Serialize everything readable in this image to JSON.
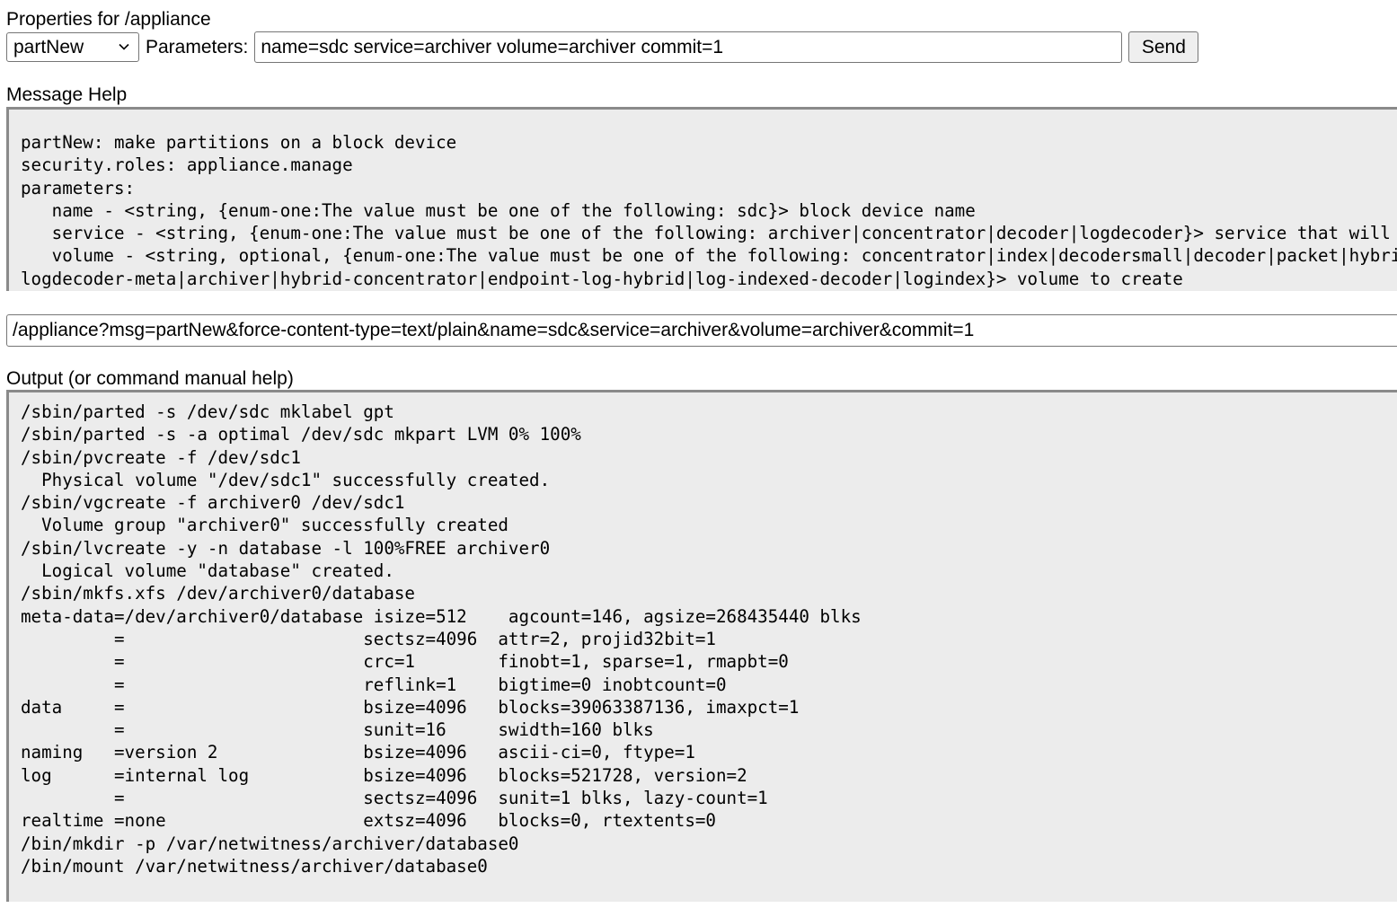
{
  "header": {
    "title": "Properties for /appliance"
  },
  "controls": {
    "message_select_value": "partNew",
    "parameters_label": "Parameters:",
    "parameters_value": "name=sdc service=archiver volume=archiver commit=1",
    "send_label": "Send"
  },
  "help": {
    "label": "Message Help",
    "text": "partNew: make partitions on a block device\nsecurity.roles: appliance.manage\nparameters:\n   name - <string, {enum-one:The value must be one of the following: sdc}> block device name\n   service - <string, {enum-one:The value must be one of the following: archiver|concentrator|decoder|logdecoder}> service that will\n   volume - <string, optional, {enum-one:The value must be one of the following: concentrator|index|decodersmall|decoder|packet|hybrid\nlogdecoder-meta|archiver|hybrid-concentrator|endpoint-log-hybrid|log-indexed-decoder|logindex}> volume to create"
  },
  "url": {
    "value": "/appliance?msg=partNew&force-content-type=text/plain&name=sdc&service=archiver&volume=archiver&commit=1"
  },
  "output": {
    "label": "Output (or command manual help)",
    "text": "/sbin/parted -s /dev/sdc mklabel gpt\n/sbin/parted -s -a optimal /dev/sdc mkpart LVM 0% 100%\n/sbin/pvcreate -f /dev/sdc1\n  Physical volume \"/dev/sdc1\" successfully created.\n/sbin/vgcreate -f archiver0 /dev/sdc1\n  Volume group \"archiver0\" successfully created\n/sbin/lvcreate -y -n database -l 100%FREE archiver0\n  Logical volume \"database\" created.\n/sbin/mkfs.xfs /dev/archiver0/database\nmeta-data=/dev/archiver0/database isize=512    agcount=146, agsize=268435440 blks\n         =                       sectsz=4096  attr=2, projid32bit=1\n         =                       crc=1        finobt=1, sparse=1, rmapbt=0\n         =                       reflink=1    bigtime=0 inobtcount=0\ndata     =                       bsize=4096   blocks=39063387136, imaxpct=1\n         =                       sunit=16     swidth=160 blks\nnaming   =version 2              bsize=4096   ascii-ci=0, ftype=1\nlog      =internal log           bsize=4096   blocks=521728, version=2\n         =                       sectsz=4096  sunit=1 blks, lazy-count=1\nrealtime =none                   extsz=4096   blocks=0, rtextents=0\n/bin/mkdir -p /var/netwitness/archiver/database0\n/bin/mount /var/netwitness/archiver/database0"
  },
  "icons": {
    "select_chevron": "chevron-down-icon"
  }
}
